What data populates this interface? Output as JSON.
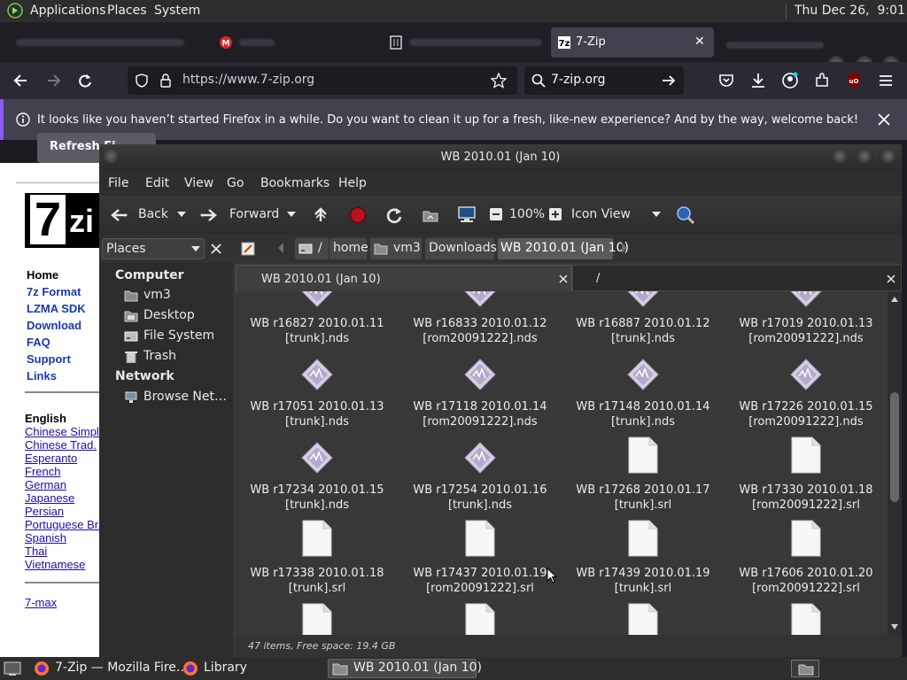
{
  "top_panel": {
    "menus": [
      "Applications",
      "Places",
      "System"
    ],
    "clock": "Thu Dec 26,  9:01 PM"
  },
  "firefox": {
    "tabs": [
      {
        "label": "",
        "blurred": true
      },
      {
        "label": "",
        "blurred": true
      },
      {
        "label": "",
        "blurred": true
      },
      {
        "label": "7-Zip",
        "active": true
      }
    ],
    "url": "https://www.7-zip.org",
    "search_text": "7-zip.org",
    "notification": "It looks like you haven’t started Firefox in a while. Do you want to clean it up for a fresh, like-new experience? And by the way, welcome back!",
    "refresh_button": "Refresh Fi…",
    "accent_color": "#9059ff"
  },
  "webpage": {
    "logo_text_7": "7",
    "logo_text_z": "zi",
    "nav": [
      "Home",
      "7z Format",
      "LZMA SDK",
      "Download",
      "FAQ",
      "Support",
      "Links"
    ],
    "lang_heading": "English",
    "languages": [
      "Chinese Simpl.",
      "Chinese Trad.",
      "Esperanto",
      "French",
      "German",
      "Japanese",
      "Persian",
      "Portuguese Br.",
      "Spanish",
      "Thai",
      "Vietnamese"
    ],
    "footer_link": "7-max"
  },
  "caja": {
    "title": "WB 2010.01 (Jan 10)",
    "menus": [
      "File",
      "Edit",
      "View",
      "Go",
      "Bookmarks",
      "Help"
    ],
    "toolbar": {
      "back": "Back",
      "forward": "Forward",
      "zoom": "100%",
      "view_mode": "Icon View"
    },
    "places_combo": "Places",
    "breadcrumbs": [
      "home",
      "vm3",
      "Downloads",
      "WB 2010.01 (Jan 10)"
    ],
    "sidebar": {
      "computer_heading": "Computer",
      "computer_items": [
        "vm3",
        "Desktop",
        "File System",
        "Trash"
      ],
      "network_heading": "Network",
      "network_items": [
        "Browse Net…"
      ]
    },
    "tabs": [
      "WB 2010.01 (Jan 10)",
      "/"
    ],
    "files": [
      {
        "line1": "WB r16827 2010.01.11",
        "line2": "[trunk].nds",
        "type": "nds"
      },
      {
        "line1": "WB r16833 2010.01.12",
        "line2": "[rom20091222].nds",
        "type": "nds"
      },
      {
        "line1": "WB r16887 2010.01.12",
        "line2": "[trunk].nds",
        "type": "nds"
      },
      {
        "line1": "WB r17019 2010.01.13",
        "line2": "[rom20091222].nds",
        "type": "nds"
      },
      {
        "line1": "WB r17051 2010.01.13",
        "line2": "[trunk].nds",
        "type": "nds"
      },
      {
        "line1": "WB r17118 2010.01.14",
        "line2": "[rom20091222].nds",
        "type": "nds"
      },
      {
        "line1": "WB r17148 2010.01.14",
        "line2": "[trunk].nds",
        "type": "nds"
      },
      {
        "line1": "WB r17226 2010.01.15",
        "line2": "[rom20091222].nds",
        "type": "nds"
      },
      {
        "line1": "WB r17234 2010.01.15",
        "line2": "[trunk].nds",
        "type": "nds"
      },
      {
        "line1": "WB r17254 2010.01.16",
        "line2": "[trunk].nds",
        "type": "nds"
      },
      {
        "line1": "WB r17268 2010.01.17",
        "line2": "[trunk].srl",
        "type": "srl"
      },
      {
        "line1": "WB r17330 2010.01.18",
        "line2": "[rom20091222].srl",
        "type": "srl"
      },
      {
        "line1": "WB r17338 2010.01.18",
        "line2": "[trunk].srl",
        "type": "srl"
      },
      {
        "line1": "WB r17437 2010.01.19",
        "line2": "[rom20091222].srl",
        "type": "srl"
      },
      {
        "line1": "WB r17439 2010.01.19",
        "line2": "[trunk].srl",
        "type": "srl"
      },
      {
        "line1": "WB r17606 2010.01.20",
        "line2": "[rom20091222].srl",
        "type": "srl"
      },
      {
        "line1": "",
        "line2": "",
        "type": "srl"
      },
      {
        "line1": "",
        "line2": "",
        "type": "srl"
      },
      {
        "line1": "",
        "line2": "",
        "type": "srl"
      },
      {
        "line1": "",
        "line2": "",
        "type": "srl"
      }
    ],
    "status": "47 items, Free space: 19.4 GB"
  },
  "taskbar": {
    "tasks": [
      {
        "label": "7-Zip — Mozilla Fire…",
        "icon": "firefox-icon"
      },
      {
        "label": "Library",
        "icon": "firefox-icon"
      },
      {
        "label": "WB 2010.01 (Jan 10)",
        "icon": "folder-icon",
        "active": true
      }
    ]
  }
}
